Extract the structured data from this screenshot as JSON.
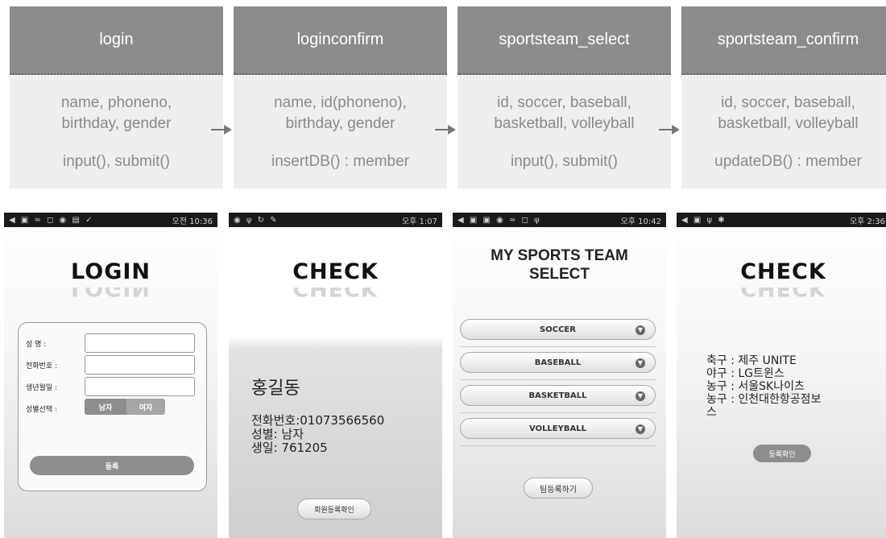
{
  "diagram": {
    "boxes": [
      {
        "title": "login",
        "lines": [
          "name, phoneno,",
          "birthday, gender",
          "input(), submit()"
        ]
      },
      {
        "title": "loginconfirm",
        "lines": [
          "name, id(phoneno),",
          "birthday, gender",
          "insertDB() : member"
        ]
      },
      {
        "title": "sportsteam_select",
        "lines": [
          "id, soccer, baseball,",
          "basketball, volleyball",
          "input(), submit()"
        ]
      },
      {
        "title": "sportsteam_confirm",
        "lines": [
          "id, soccer, baseball,",
          "basketball, volleyball",
          "updateDB() : member"
        ]
      }
    ]
  },
  "screens": {
    "login": {
      "time": "오전 10:36",
      "logo": "LOGIN",
      "labels": {
        "name": "성    명 :",
        "phone": "전화번호 :",
        "birth": "생년월일 :",
        "gender": "성별선택 :"
      },
      "gender_options": [
        "남자",
        "여자"
      ],
      "register_button": "등록"
    },
    "check1": {
      "time": "오후 1:07",
      "logo": "CHECK",
      "name": "홍길동",
      "phone": "전화번호:01073566560",
      "gender": "성별: 남자",
      "birth": "생일: 761205",
      "button": "회원등록확인"
    },
    "select": {
      "time": "오후 10:42",
      "title_line1": "MY SPORTS TEAM",
      "title_line2": "SELECT",
      "dropdowns": [
        "SOCCER",
        "BASEBALL",
        "BASKETBALL",
        "VOLLEYBALL"
      ],
      "button": "팀등록하기"
    },
    "check2": {
      "time": "오후 2:36",
      "logo": "CHECK",
      "lines": [
        "축구 : 제주 UNITE",
        "야구 : LG트윈스",
        "농구 : 서울SK나이츠",
        "농구 : 인천대한항공점보",
        "스"
      ],
      "button": "등록확인"
    }
  },
  "colors": {
    "box_header": "#8c8c8c",
    "box_body": "#eeeeee",
    "box_text": "#8a8a8a",
    "status_bar": "#1a1a1a"
  }
}
